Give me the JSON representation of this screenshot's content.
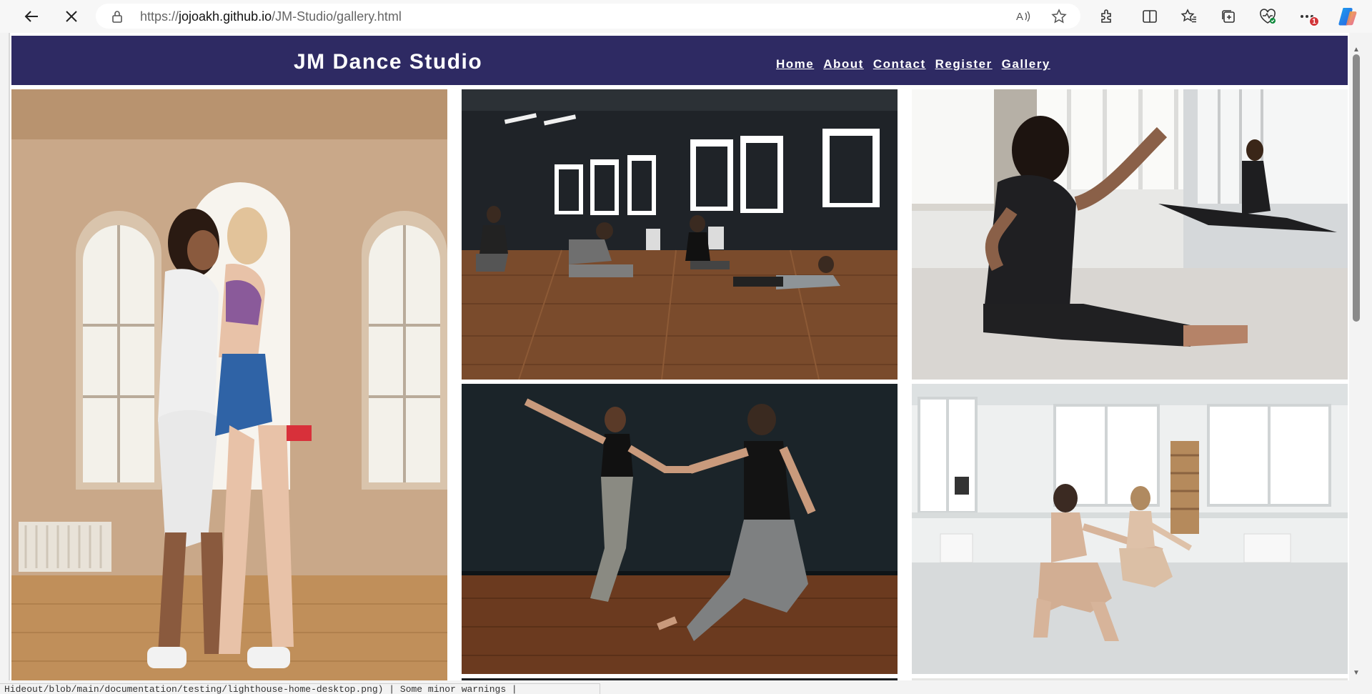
{
  "browser": {
    "url_prefix": "https://",
    "url_host": "jojoakh.github.io",
    "url_path": "/JM-Studio/gallery.html",
    "notification_count": "1"
  },
  "site": {
    "title": "JM Dance Studio",
    "nav": [
      "Home",
      "About",
      "Contact",
      "Register",
      "Gallery"
    ],
    "header_color": "#2e2a63"
  },
  "gallery": {
    "images": [
      "two-dancers-retro-outfits-photo",
      "group-floor-exercise-studio-photo",
      "male-dancer-splits-mirror-photo",
      "couple-contemporary-dance-photo",
      "two-dancers-squat-bright-studio-photo"
    ]
  },
  "status_bar": {
    "text": "Hideout/blob/main/documentation/testing/lighthouse-home-desktop.png) | Some minor warnings |"
  }
}
